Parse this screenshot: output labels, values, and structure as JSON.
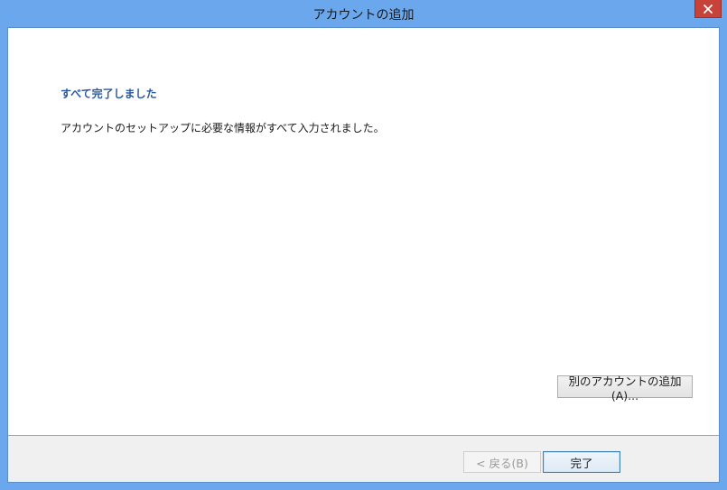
{
  "window": {
    "title": "アカウントの追加"
  },
  "main": {
    "heading": "すべて完了しました",
    "message": "アカウントのセットアップに必要な情報がすべて入力されました。",
    "add_another_label": "別のアカウントの追加(A)..."
  },
  "footer": {
    "back_label": "< 戻る(B)",
    "finish_label": "完了"
  },
  "colors": {
    "titlebar": "#6aa7ec",
    "heading": "#2a5a9c",
    "close_button": "#c7433a"
  }
}
